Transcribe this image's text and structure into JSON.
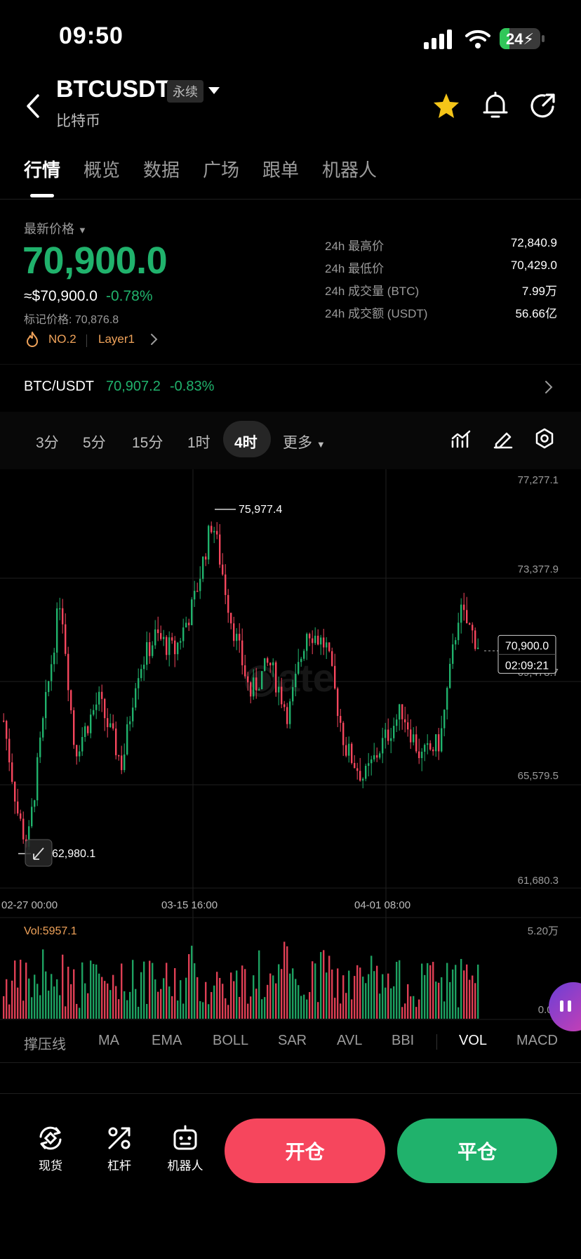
{
  "status_bar": {
    "time": "09:50",
    "battery": "24",
    "battery_level": 0.24
  },
  "header": {
    "symbol": "BTCUSDT",
    "contract_type": "永续",
    "subtitle": "比特币"
  },
  "tabs": [
    {
      "label": "行情",
      "active": true
    },
    {
      "label": "概览"
    },
    {
      "label": "数据"
    },
    {
      "label": "广场"
    },
    {
      "label": "跟单"
    },
    {
      "label": "机器人"
    }
  ],
  "price": {
    "label": "最新价格",
    "last": "70,900.0",
    "usd_equiv": "≈$70,900.0",
    "change_pct": "-0.78%",
    "mark_price": "标记价格: 70,876.8",
    "rank": "NO.2",
    "tag": "Layer1"
  },
  "stats": [
    {
      "label": "24h 最高价",
      "value": "72,840.9"
    },
    {
      "label": "24h 最低价",
      "value": "70,429.0"
    },
    {
      "label": "24h 成交量 (BTC)",
      "value": "7.99万"
    },
    {
      "label": "24h 成交额 (USDT)",
      "value": "56.66亿"
    }
  ],
  "spot_pair": {
    "name": "BTC/USDT",
    "price": "70,907.2",
    "change": "-0.83%"
  },
  "intervals": [
    {
      "label": "3分"
    },
    {
      "label": "5分"
    },
    {
      "label": "15分"
    },
    {
      "label": "1时"
    },
    {
      "label": "4时",
      "active": true
    },
    {
      "label": "更多"
    }
  ],
  "chart_data": {
    "type": "candlestick",
    "y_ticks": [
      "77,277.1",
      "73,377.9",
      "69,478.7",
      "65,579.5",
      "61,680.3"
    ],
    "ylim": [
      61680.3,
      77277.1
    ],
    "x_ticks": [
      "02-27 00:00",
      "03-15 16:00",
      "04-01 08:00"
    ],
    "high_marker": "75,977.4",
    "low_marker": "62,980.1",
    "current_price": "70,900.0",
    "countdown": "02:09:21",
    "close_points": [
      [
        0,
        68000
      ],
      [
        3,
        64500
      ],
      [
        5,
        63200
      ],
      [
        8,
        67500
      ],
      [
        12,
        72800
      ],
      [
        15,
        66800
      ],
      [
        20,
        68800
      ],
      [
        25,
        66300
      ],
      [
        28,
        69800
      ],
      [
        32,
        71200
      ],
      [
        36,
        70600
      ],
      [
        40,
        72400
      ],
      [
        44,
        75600
      ],
      [
        48,
        71800
      ],
      [
        52,
        69000
      ],
      [
        56,
        70200
      ],
      [
        60,
        68200
      ],
      [
        64,
        71500
      ],
      [
        68,
        70800
      ],
      [
        72,
        67000
      ],
      [
        76,
        65800
      ],
      [
        80,
        67200
      ],
      [
        84,
        68400
      ],
      [
        88,
        66600
      ],
      [
        92,
        67200
      ],
      [
        96,
        72200
      ],
      [
        100,
        70900
      ]
    ],
    "green": "#20b26c",
    "red": "#f6465d",
    "volume": {
      "label": "Vol:5957.1",
      "max_tick": "5.20万",
      "min_tick": "0.00"
    }
  },
  "indicators": [
    {
      "label": "撑压线"
    },
    {
      "label": "MA"
    },
    {
      "label": "EMA"
    },
    {
      "label": "BOLL"
    },
    {
      "label": "SAR"
    },
    {
      "label": "AVL"
    },
    {
      "label": "BBI"
    },
    {
      "label": "VOL",
      "active": true
    },
    {
      "label": "MACD"
    }
  ],
  "bottom_nav": [
    {
      "label": "现货",
      "icon": "spot-icon"
    },
    {
      "label": "杠杆",
      "icon": "leverage-icon"
    },
    {
      "label": "机器人",
      "icon": "robot-icon"
    }
  ],
  "actions": {
    "open": "开仓",
    "close": "平仓"
  },
  "colors": {
    "green": "#20b26c",
    "red": "#f6465d",
    "star": "#f5c518",
    "orange": "#f0a35a"
  }
}
